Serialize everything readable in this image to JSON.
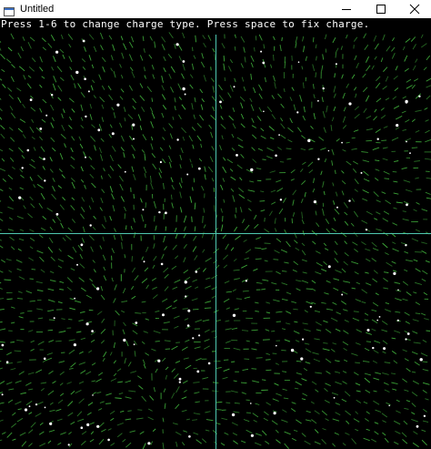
{
  "window": {
    "title": "Untitled",
    "controls": {
      "minimize_icon": "minimize-icon",
      "maximize_icon": "maximize-icon",
      "close_icon": "close-icon"
    }
  },
  "canvas": {
    "background": "#000000",
    "instructions": "Press 1-6 to change charge type. Press space to fix charge.",
    "colors": {
      "field_vector": "#3fae3a",
      "axis_line": "#4fc7b0",
      "charge_particle": "#ffffff",
      "instruction_text": "#ffffff"
    },
    "quadrant_lines": {
      "vertical": true,
      "horizontal": true
    },
    "charges": [
      {
        "name": "charge-upper-right"
      },
      {
        "name": "charge-lower-left"
      },
      {
        "name": "charge-bottom-center"
      }
    ]
  }
}
